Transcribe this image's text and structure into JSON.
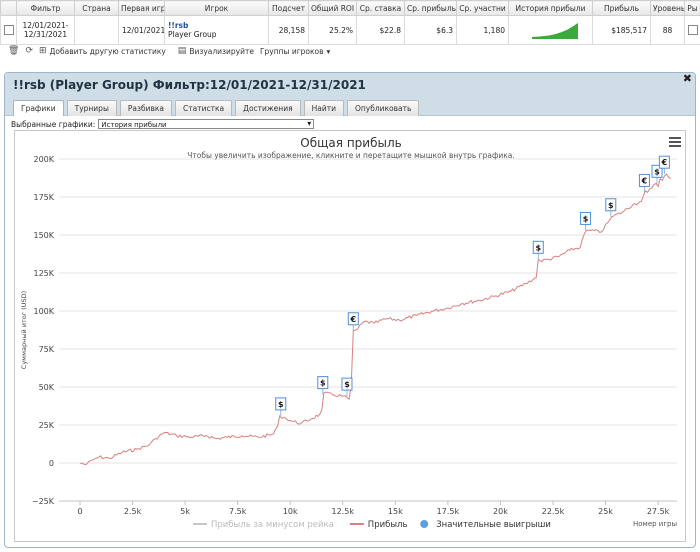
{
  "stats_table": {
    "headers": [
      "",
      "Фильтр",
      "Страна",
      "Первая игр",
      "Игрок",
      "Подсчет",
      "Общий ROI",
      "Ср. ставка",
      "Ср. прибыль",
      "Ср. участни",
      "История прибыли",
      "Прибыль",
      "Уровень",
      "Ры"
    ],
    "row": {
      "filter_line1": "12/01/2021-",
      "filter_line2": "12/31/2021",
      "country": "",
      "first_game": "12/01/2021",
      "player_name": "!!rsb",
      "player_group": "Player Group",
      "count": "28,158",
      "roi": "25.2%",
      "avg_stake": "$22.8",
      "avg_profit": "$6.3",
      "avg_entrants": "1,180",
      "profit": "$185,517",
      "level": "88",
      "extra": ""
    },
    "sparkline_color": "#3aaa3a",
    "sparkline_profile": [
      0,
      0.02,
      0.03,
      0.05,
      0.08,
      0.1,
      0.15,
      0.2,
      0.28,
      0.35,
      0.45,
      0.55,
      0.7,
      0.85,
      1.0
    ]
  },
  "toolbar": {
    "delete_icon": "trash-icon",
    "refresh_icon": "refresh-icon",
    "add_stat_label": "Добавить другую статистику",
    "visualize_label": "Визуализируйте",
    "groups_label": "Группы игроков"
  },
  "panel": {
    "title": "!!rsb (Player Group) Фильтр:12/01/2021-12/31/2021",
    "close_glyph": "✖",
    "tabs": [
      "Графики",
      "Турниры",
      "Разбивка",
      "Статистка",
      "Достижения",
      "Найти",
      "Опубликовать"
    ],
    "active_tab": 0,
    "selected_charts_label": "Выбранные графики:",
    "selected_chart_value": "История прибыли"
  },
  "chart_data": {
    "type": "line",
    "title": "Общая прибыль",
    "subtitle": "Чтобы увеличить изображение, кликните и перетащите мышкой внутрь графика.",
    "xlabel": "Номер игры",
    "ylabel": "Суммарный итог (USD)",
    "xlim": [
      -1000,
      28400
    ],
    "ylim": [
      -25000,
      200000
    ],
    "x_ticks": [
      0,
      2500,
      5000,
      7500,
      10000,
      12500,
      15000,
      17500,
      20000,
      22500,
      25000,
      27500
    ],
    "x_tick_labels": [
      "0",
      "2.5k",
      "5k",
      "7.5k",
      "10k",
      "12.5k",
      "15k",
      "17.5k",
      "20k",
      "22.5k",
      "25k",
      "27.5k"
    ],
    "y_ticks": [
      -25000,
      0,
      25000,
      50000,
      75000,
      100000,
      125000,
      150000,
      175000,
      200000
    ],
    "y_tick_labels": [
      "−25K",
      "0",
      "25K",
      "50K",
      "75K",
      "100K",
      "125K",
      "150K",
      "175K",
      "200K"
    ],
    "series": [
      {
        "name": "Прибыль",
        "color": "#d98080",
        "x": [
          0,
          300,
          600,
          900,
          1400,
          2000,
          2700,
          3300,
          3600,
          4000,
          4600,
          5300,
          6000,
          6500,
          7000,
          7700,
          8500,
          9200,
          9400,
          9500,
          9700,
          10000,
          10500,
          11000,
          11400,
          11500,
          11600,
          12000,
          12500,
          12800,
          12900,
          13000,
          13200,
          13500,
          14000,
          14600,
          15200,
          16000,
          16800,
          17500,
          18200,
          19000,
          19800,
          20500,
          21200,
          21700,
          21800,
          21900,
          22300,
          22800,
          23300,
          23800,
          24000,
          24100,
          24300,
          24800,
          25100,
          25200,
          25300,
          25800,
          26300,
          26700,
          26800,
          26900,
          27000,
          27200,
          27400,
          27500,
          27600,
          27700,
          27900,
          28100
        ],
        "y": [
          0,
          -1000,
          2000,
          4000,
          3000,
          7000,
          9000,
          12000,
          16000,
          20000,
          18000,
          17000,
          18000,
          16000,
          17000,
          18000,
          17000,
          19000,
          24000,
          31000,
          30000,
          28000,
          26000,
          29000,
          32000,
          35000,
          46000,
          45000,
          44000,
          42000,
          51000,
          87000,
          88000,
          93000,
          92000,
          95000,
          94000,
          97000,
          100000,
          102000,
          105000,
          107000,
          110000,
          113000,
          118000,
          122000,
          134000,
          133000,
          134000,
          136000,
          140000,
          142000,
          151000,
          153000,
          153000,
          152000,
          158000,
          160000,
          162000,
          165000,
          170000,
          172000,
          176000,
          179000,
          178000,
          181000,
          184000,
          182000,
          187000,
          186000,
          190000,
          187000
        ]
      }
    ],
    "markers": [
      {
        "x": 9550,
        "y": 31000,
        "label": "$"
      },
      {
        "x": 11550,
        "y": 45000,
        "label": "$"
      },
      {
        "x": 12700,
        "y": 44000,
        "label": "$"
      },
      {
        "x": 13000,
        "y": 87000,
        "label": "€"
      },
      {
        "x": 21800,
        "y": 134000,
        "label": "$"
      },
      {
        "x": 24050,
        "y": 153000,
        "label": "$"
      },
      {
        "x": 25250,
        "y": 162000,
        "label": "$"
      },
      {
        "x": 26850,
        "y": 178000,
        "label": "€"
      },
      {
        "x": 27450,
        "y": 184000,
        "label": "$"
      },
      {
        "x": 27800,
        "y": 190000,
        "label": "€"
      }
    ],
    "legend": [
      {
        "label": "Прибыль за минусом рейка",
        "color": "#c8c8c8",
        "style": "line",
        "enabled": false
      },
      {
        "label": "Прибыль",
        "color": "#d98080",
        "style": "line",
        "enabled": true
      },
      {
        "label": "Значительные выигрыши",
        "color": "#5aa0e0",
        "style": "dot",
        "enabled": true
      }
    ],
    "legend_position": "bottom",
    "grid": true
  }
}
